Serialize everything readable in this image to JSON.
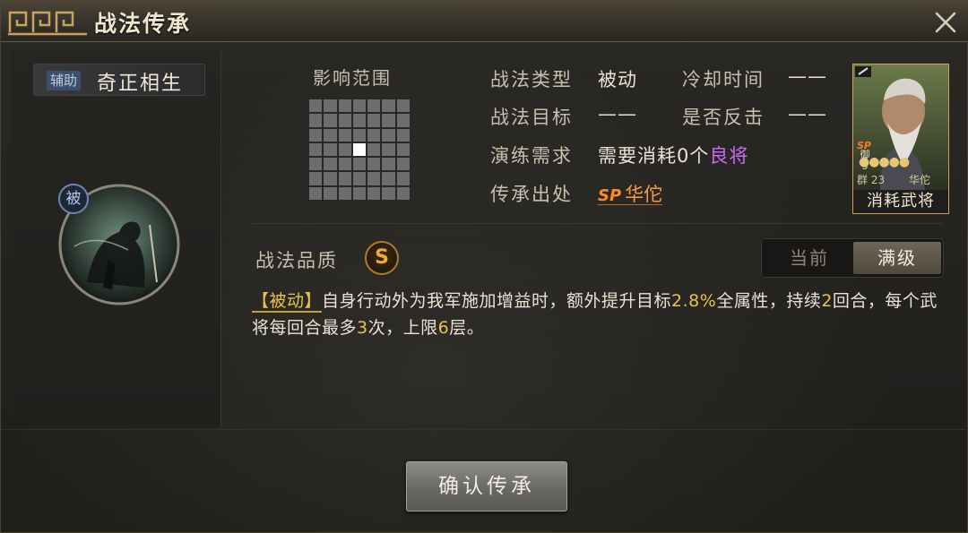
{
  "window": {
    "title": "战法传承",
    "close_icon": "close-icon"
  },
  "skill": {
    "tag": "辅助",
    "name": "奇正相生",
    "emblem_badge": "被"
  },
  "range": {
    "label": "影响范围",
    "grid_size": 7,
    "active_cell": [
      3,
      3
    ]
  },
  "info": {
    "type_label": "战法类型",
    "type_value": "被动",
    "cooldown_label": "冷却时间",
    "cooldown_value": "——",
    "target_label": "战法目标",
    "target_value": "——",
    "counter_label": "是否反击",
    "counter_value": "——",
    "drill_label": "演练需求",
    "drill_prefix": "需要消耗0个",
    "drill_grade": "良将",
    "source_label": "传承出处",
    "source_badge": "SP",
    "source_name": "华佗"
  },
  "general_card": {
    "faction_level_top": "御",
    "level_num": "5",
    "sp": "SP",
    "stars": "●●●●●",
    "cost": "群 23",
    "name": "华佗",
    "caption": "消耗武将"
  },
  "quality": {
    "label": "战法品质",
    "grade": "S"
  },
  "level_toggle": {
    "current_label": "当前",
    "max_label": "满级",
    "selected": "max"
  },
  "description": {
    "tag": "【被动】",
    "text_1": "自身行动外为我军施加增益时，额外提升目标",
    "num_1": "2.8%",
    "text_2": "全属性，持续",
    "num_2": "2",
    "text_3": "回合，每个武将每回合最多",
    "num_3": "3",
    "text_4": "次，上限",
    "num_4": "6",
    "text_5": "层。"
  },
  "actions": {
    "confirm_label": "确认传承"
  },
  "colors": {
    "accent_gold": "#e8c34a",
    "grade_purple": "#c76df2",
    "source_orange": "#ff9a3a"
  }
}
